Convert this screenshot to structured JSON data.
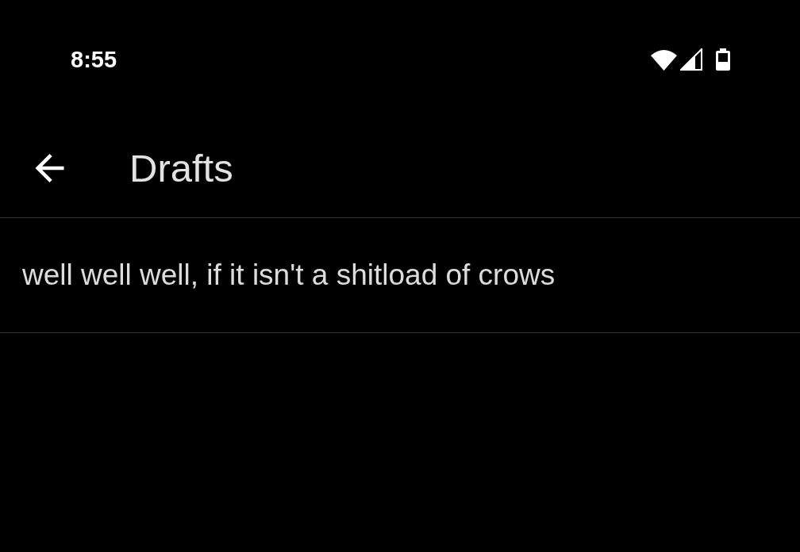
{
  "status_bar": {
    "time": "8:55"
  },
  "app_bar": {
    "title": "Drafts"
  },
  "drafts": [
    {
      "text": "well well well, if it isn't a shitload of crows"
    }
  ]
}
